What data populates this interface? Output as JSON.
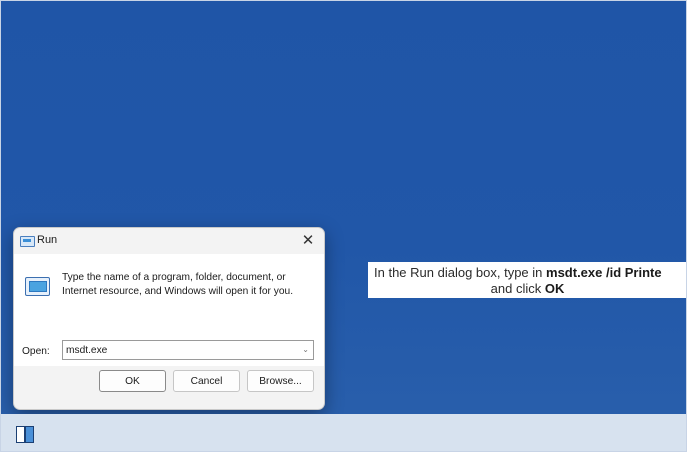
{
  "run_dialog": {
    "title": "Run",
    "instructions": "Type the name of a program, folder, document, or Internet resource, and Windows will open it for you.",
    "open_label": "Open:",
    "open_value": "msdt.exe",
    "ok_label": "OK",
    "cancel_label": "Cancel",
    "browse_label": "Browse...",
    "close_symbol": "✕",
    "dropdown_symbol": "⌄"
  },
  "caption": {
    "line1_prefix": "In the Run dialog box, type in ",
    "line1_bold": "msdt.exe /id Printe",
    "line2_prefix": "and click ",
    "line2_bold": "OK"
  },
  "icons": {
    "run_title_icon": "run-icon",
    "run_body_icon": "run-program-icon",
    "taskbar_icon": "taskbar-window-icon"
  },
  "colors": {
    "desktop": "#1f56a7",
    "taskbar": "#d7e2ef",
    "dialog": "#f3f3f3"
  }
}
